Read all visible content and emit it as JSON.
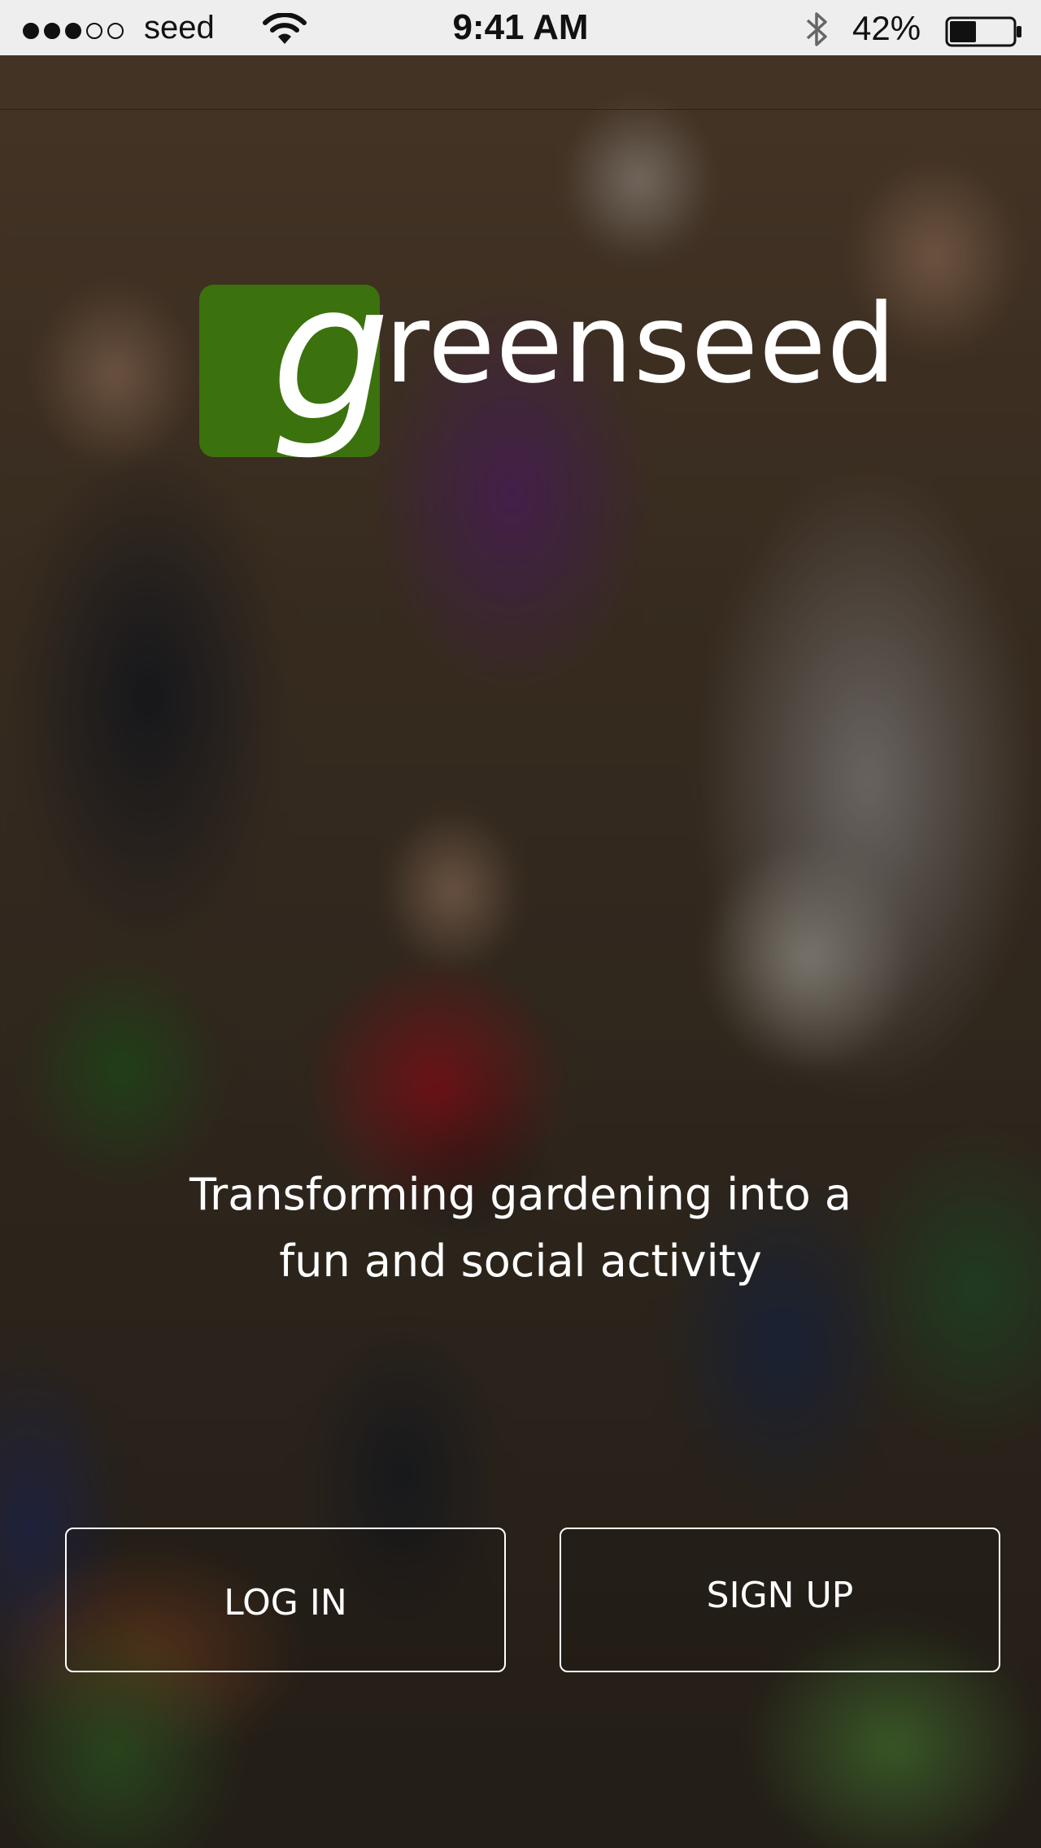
{
  "status_bar": {
    "signal": {
      "filled": 3,
      "total": 5
    },
    "carrier": "seed",
    "wifi_icon": "wifi-icon",
    "time": "9:41 AM",
    "bluetooth_icon": "bluetooth-icon",
    "battery_percent": "42%",
    "battery_level": 0.42
  },
  "logo": {
    "letter": "g",
    "wordmark": "reenseed",
    "box_color": "#3b720d"
  },
  "tagline": {
    "line1": "Transforming gardening into a",
    "line2": "fun and social activity"
  },
  "buttons": {
    "login_label": "LOG IN",
    "signup_label": "SIGN UP"
  }
}
